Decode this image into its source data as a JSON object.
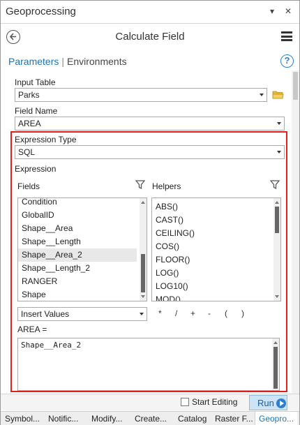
{
  "window": {
    "title": "Geoprocessing",
    "pin_glyph": "▾",
    "close_glyph": "✕"
  },
  "header": {
    "title": "Calculate Field"
  },
  "tabs": {
    "parameters": "Parameters",
    "separator": "|",
    "environments": "Environments",
    "help_glyph": "?"
  },
  "input_table": {
    "label": "Input Table",
    "value": "Parks"
  },
  "field_name": {
    "label": "Field Name",
    "value": "AREA"
  },
  "expression_type": {
    "label": "Expression Type",
    "value": "SQL"
  },
  "expression": {
    "label": "Expression"
  },
  "fields": {
    "label": "Fields",
    "items": [
      "Condition",
      "GlobalID",
      "Shape__Area",
      "Shape__Length",
      "Shape__Area_2",
      "Shape__Length_2",
      "RANGER",
      "Shape"
    ],
    "selected": "Shape__Area_2"
  },
  "helpers": {
    "label": "Helpers",
    "items": [
      "ABS()",
      "CAST()",
      "CEILING()",
      "COS()",
      "FLOOR()",
      "LOG()",
      "LOG10()",
      "MOD()"
    ]
  },
  "insert_values": {
    "value": "Insert Values"
  },
  "operators": [
    "*",
    "/",
    "+",
    "-",
    "(",
    ")"
  ],
  "expression_target": {
    "label": "AREA ="
  },
  "expression_text": "Shape__Area_2",
  "footer": {
    "start_editing": "Start Editing",
    "run": "Run"
  },
  "bottom_tabs": [
    "Symbol...",
    "Notific...",
    "Modify...",
    "Create...",
    "Catalog",
    "Raster F...",
    "Geopro..."
  ],
  "colors": {
    "accent": "#1f72b8",
    "highlight_border": "#e0201f",
    "run_bg": "#cde4f7"
  }
}
